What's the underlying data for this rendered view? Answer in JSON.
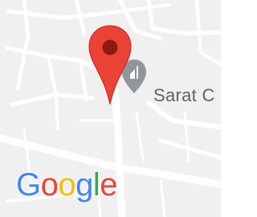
{
  "map": {
    "place_label": "Sarat C",
    "pin_icon": "map-pin-icon",
    "place_icon": "place-marker-icon",
    "logo_letters": [
      {
        "char": "G",
        "color": "#4285F4"
      },
      {
        "char": "o",
        "color": "#EA4335"
      },
      {
        "char": "o",
        "color": "#FBBC05"
      },
      {
        "char": "g",
        "color": "#4285F4"
      },
      {
        "char": "l",
        "color": "#34A853"
      },
      {
        "char": "e",
        "color": "#EA4335"
      }
    ],
    "colors": {
      "land": "#f0f0f0",
      "road": "#ffffff",
      "pin_red": "#EA4335",
      "pin_dot": "#8b1a12",
      "place_icon_gray": "#8f969d",
      "label_gray": "#5f6368"
    }
  }
}
